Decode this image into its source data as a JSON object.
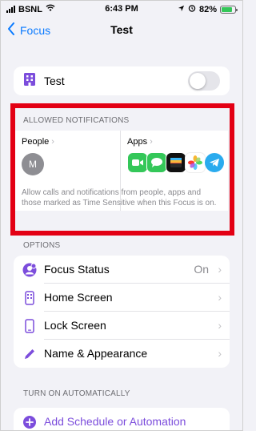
{
  "status_bar": {
    "carrier": "BSNL",
    "time": "6:43 PM",
    "battery_percent": "82%",
    "battery_level": 0.82,
    "icons": [
      "signal-icon",
      "wifi-icon",
      "location-icon",
      "alarm-icon",
      "battery-icon"
    ]
  },
  "nav": {
    "back_label": "Focus",
    "title": "Test"
  },
  "focus_toggle": {
    "label": "Test",
    "enabled": false
  },
  "allowed_notifications": {
    "header": "ALLOWED NOTIFICATIONS",
    "people_label": "People",
    "people_avatar_initial": "M",
    "apps_label": "Apps",
    "apps_icons": [
      "facetime-icon",
      "messages-icon",
      "wallet-icon",
      "photos-icon",
      "telegram-icon"
    ],
    "note": "Allow calls and notifications from people, apps and those marked as Time Sensitive when this Focus is on."
  },
  "options": {
    "header": "OPTIONS",
    "items": [
      {
        "label": "Focus Status",
        "value": "On"
      },
      {
        "label": "Home Screen",
        "value": ""
      },
      {
        "label": "Lock Screen",
        "value": ""
      },
      {
        "label": "Name & Appearance",
        "value": ""
      }
    ]
  },
  "turn_on_automatically": {
    "header": "TURN ON AUTOMATICALLY",
    "add_label": "Add Schedule or Automation"
  },
  "colors": {
    "accent_blue": "#0a7aff",
    "purple": "#7c4ddc",
    "highlight_red": "#e30014",
    "background": "#f2f2f7"
  }
}
